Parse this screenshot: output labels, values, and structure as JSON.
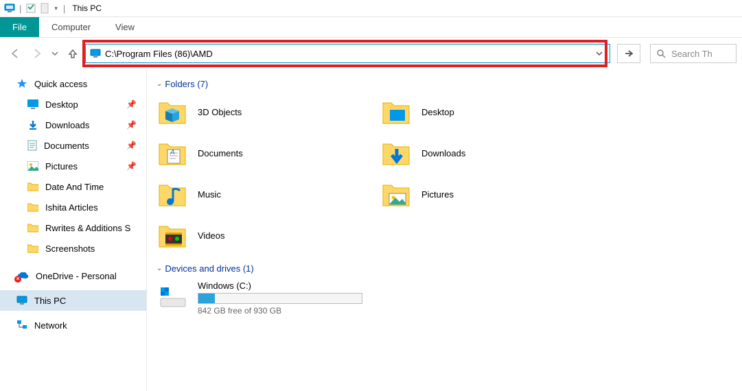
{
  "title": "This PC",
  "menubar": {
    "file": "File",
    "computer": "Computer",
    "view": "View"
  },
  "nav": {
    "address": "C:\\Program Files (86)\\AMD",
    "search_placeholder": "Search Th"
  },
  "sidebar": {
    "quick": "Quick access",
    "items": [
      {
        "label": "Desktop",
        "icon": "desktop",
        "pin": true
      },
      {
        "label": "Downloads",
        "icon": "downloads",
        "pin": true
      },
      {
        "label": "Documents",
        "icon": "documents",
        "pin": true
      },
      {
        "label": "Pictures",
        "icon": "pictures",
        "pin": true
      },
      {
        "label": "Date And Time",
        "icon": "folder",
        "pin": false
      },
      {
        "label": "Ishita Articles",
        "icon": "folder",
        "pin": false
      },
      {
        "label": "Rwrites & Additions S",
        "icon": "folder",
        "pin": false
      },
      {
        "label": "Screenshots",
        "icon": "folder",
        "pin": false
      }
    ],
    "onedrive": "OneDrive - Personal",
    "thispc": "This PC",
    "network": "Network"
  },
  "groups": {
    "folders_head": "Folders (7)",
    "folders": [
      {
        "label": "3D Objects",
        "icon": "3d"
      },
      {
        "label": "Desktop",
        "icon": "desktop-big"
      },
      {
        "label": "Documents",
        "icon": "documents-big"
      },
      {
        "label": "Downloads",
        "icon": "downloads-big"
      },
      {
        "label": "Music",
        "icon": "music"
      },
      {
        "label": "Pictures",
        "icon": "pictures-big"
      },
      {
        "label": "Videos",
        "icon": "videos"
      }
    ],
    "drives_head": "Devices and drives (1)",
    "drive": {
      "label": "Windows (C:)",
      "free_text": "842 GB free of 930 GB",
      "used_pct": 10
    }
  }
}
